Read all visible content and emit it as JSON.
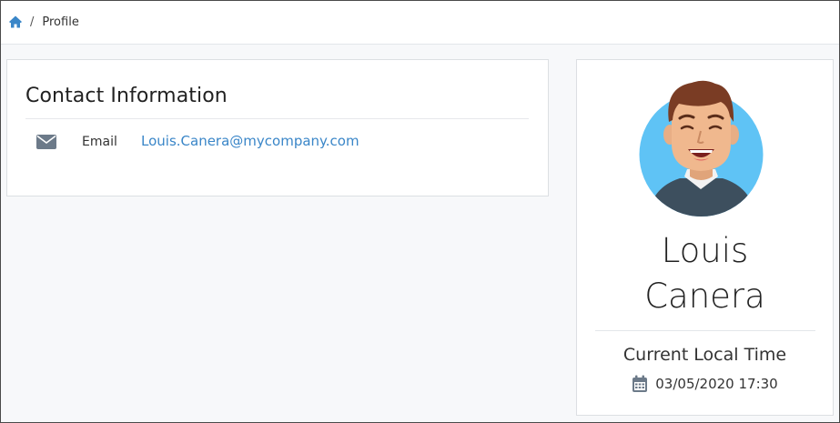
{
  "breadcrumb": {
    "home_icon": "home-icon",
    "separator": "/",
    "current": "Profile"
  },
  "contact": {
    "title": "Contact Information",
    "rows": [
      {
        "icon": "envelope-icon",
        "label": "Email",
        "value": "Louis.Canera@mycompany.com"
      }
    ]
  },
  "profile": {
    "avatar_icon": "avatar",
    "first_name": "Louis",
    "last_name": "Canera",
    "time_label": "Current Local Time",
    "time_icon": "calendar-icon",
    "time_value": "03/05/2020 17:30"
  },
  "colors": {
    "accent": "#3a86c8",
    "avatar_bg": "#5fc3f5"
  }
}
